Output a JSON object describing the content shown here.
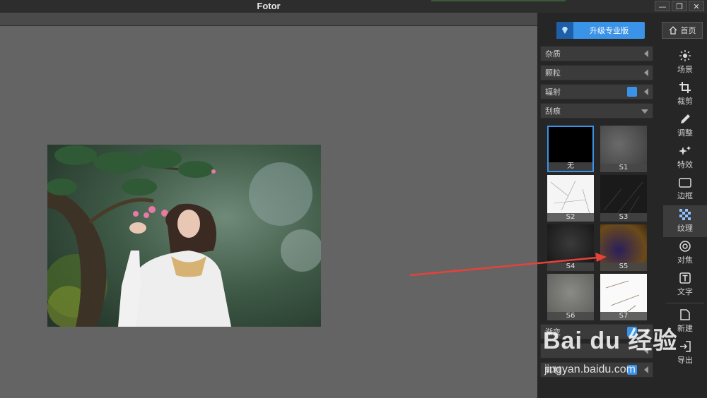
{
  "window": {
    "title": "Fotor",
    "buttons": [
      "—",
      "❐",
      "✕"
    ]
  },
  "upgrade_label": "升级专业版",
  "home_label": "首页",
  "categories": [
    {
      "label": "杂质",
      "pro": false,
      "expanded": false
    },
    {
      "label": "颗粒",
      "pro": false,
      "expanded": false
    },
    {
      "label": "辐射",
      "pro": true,
      "expanded": false
    },
    {
      "label": "刮痕",
      "pro": false,
      "expanded": true
    }
  ],
  "thumbnails": [
    {
      "label": "无",
      "selected": true
    },
    {
      "label": "S1",
      "selected": false
    },
    {
      "label": "S2",
      "selected": false
    },
    {
      "label": "S3",
      "selected": false
    },
    {
      "label": "S4",
      "selected": false
    },
    {
      "label": "S5",
      "selected": false
    },
    {
      "label": "S6",
      "selected": false
    },
    {
      "label": "S7",
      "selected": false
    }
  ],
  "lower_categories": [
    {
      "label": "渐变",
      "pro": true
    },
    {
      "label": "",
      "pro": false
    },
    {
      "label": "轧制",
      "pro": true
    }
  ],
  "tools": [
    {
      "label": "场景",
      "icon": "sun-icon"
    },
    {
      "label": "裁剪",
      "icon": "crop-icon"
    },
    {
      "label": "调整",
      "icon": "pencil-icon"
    },
    {
      "label": "特效",
      "icon": "sparkle-icon"
    },
    {
      "label": "边框",
      "icon": "frame-icon"
    },
    {
      "label": "纹理",
      "icon": "texture-icon",
      "active": true
    },
    {
      "label": "对焦",
      "icon": "focus-icon"
    },
    {
      "label": "文字",
      "icon": "text-icon"
    },
    {
      "label": "新建",
      "icon": "new-file-icon"
    },
    {
      "label": "导出",
      "icon": "export-icon"
    }
  ],
  "watermark": {
    "brand": "Bai du 经验",
    "url": "jingyan.baidu.com"
  },
  "colors": {
    "accent": "#3b93e8",
    "arrow": "#e8413a"
  }
}
